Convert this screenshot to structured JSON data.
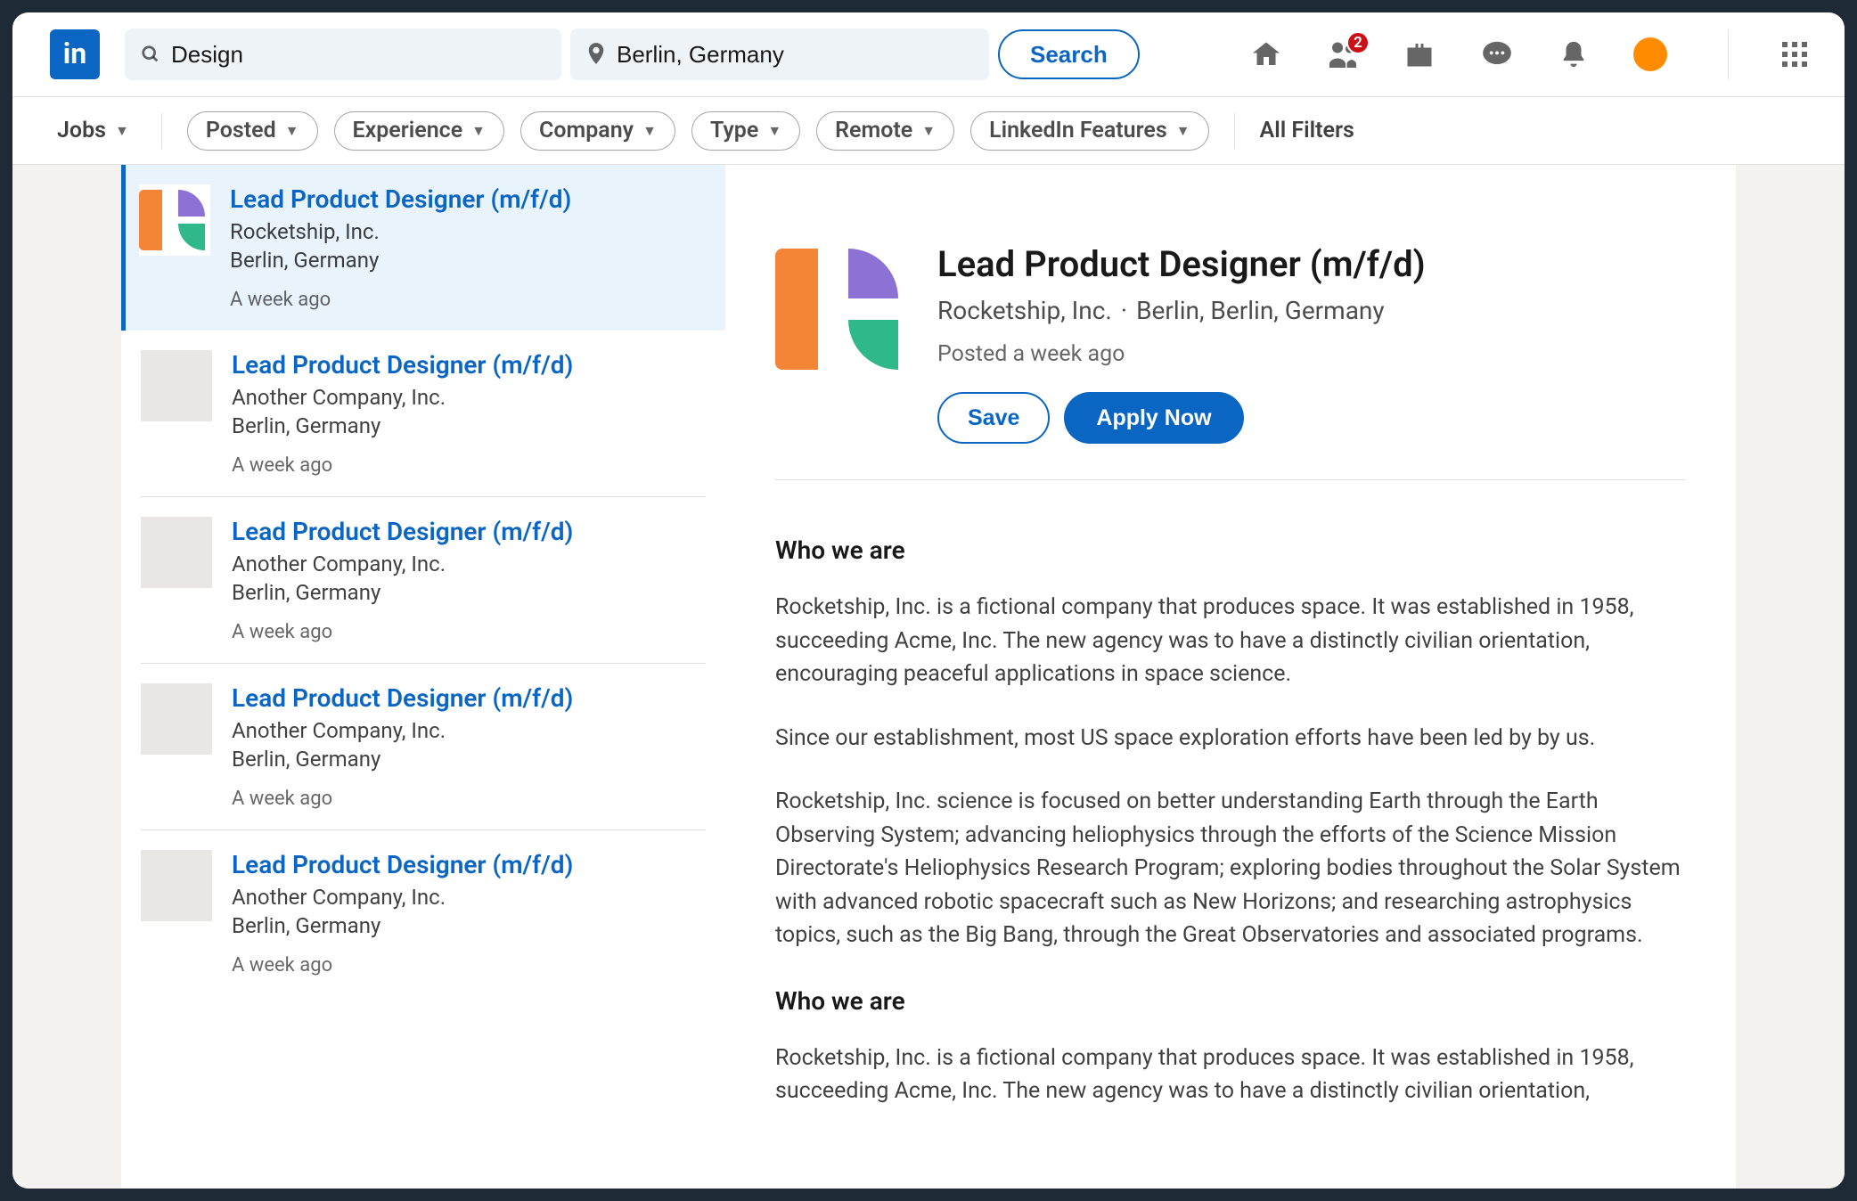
{
  "header": {
    "search_value": "Design",
    "location_value": "Berlin, Germany",
    "search_button": "Search",
    "network_badge": "2"
  },
  "filters": {
    "jobs_label": "Jobs",
    "pills": [
      "Posted",
      "Experience",
      "Company",
      "Type",
      "Remote",
      "LinkedIn Features"
    ],
    "all_filters": "All Filters"
  },
  "jobs": [
    {
      "title": "Lead Product Designer (m/f/d)",
      "company": "Rocketship, Inc.",
      "location": "Berlin, Germany",
      "time": "A week ago",
      "logo": "rocket",
      "selected": true
    },
    {
      "title": "Lead Product Designer (m/f/d)",
      "company": "Another Company, Inc.",
      "location": "Berlin, Germany",
      "time": "A week ago",
      "logo": "blank",
      "selected": false
    },
    {
      "title": "Lead Product Designer (m/f/d)",
      "company": "Another Company, Inc.",
      "location": "Berlin, Germany",
      "time": "A week ago",
      "logo": "blank",
      "selected": false
    },
    {
      "title": "Lead Product Designer (m/f/d)",
      "company": "Another Company, Inc.",
      "location": "Berlin, Germany",
      "time": "A week ago",
      "logo": "blank",
      "selected": false
    },
    {
      "title": "Lead Product Designer (m/f/d)",
      "company": "Another Company, Inc.",
      "location": "Berlin, Germany",
      "time": "A week ago",
      "logo": "blank",
      "selected": false
    }
  ],
  "detail": {
    "title": "Lead Product Designer (m/f/d)",
    "company": "Rocketship, Inc.",
    "location": "Berlin, Berlin, Germany",
    "posted": "Posted a week ago",
    "save_label": "Save",
    "apply_label": "Apply Now",
    "sections": [
      {
        "heading": "Who we are",
        "paragraphs": [
          "Rocketship, Inc. is a fictional company that produces space. It was established in 1958, succeeding Acme, Inc. The new agency was to have a distinctly civilian orientation, encouraging peaceful applications in space science.",
          "Since our establishment, most US space exploration efforts have been led by by us.",
          "Rocketship, Inc. science is focused on better understanding Earth through the Earth Observing System; advancing heliophysics through the efforts of the Science Mission Directorate's Heliophysics Research Program; exploring bodies throughout the Solar System with advanced robotic spacecraft such as New Horizons; and researching astrophysics topics, such as the Big Bang, through the Great Observatories and associated programs."
        ]
      },
      {
        "heading": "Who we are",
        "paragraphs": [
          "Rocketship, Inc. is a fictional company that produces space. It was established in 1958, succeeding Acme, Inc. The new agency was to have a distinctly civilian orientation,"
        ]
      }
    ]
  }
}
